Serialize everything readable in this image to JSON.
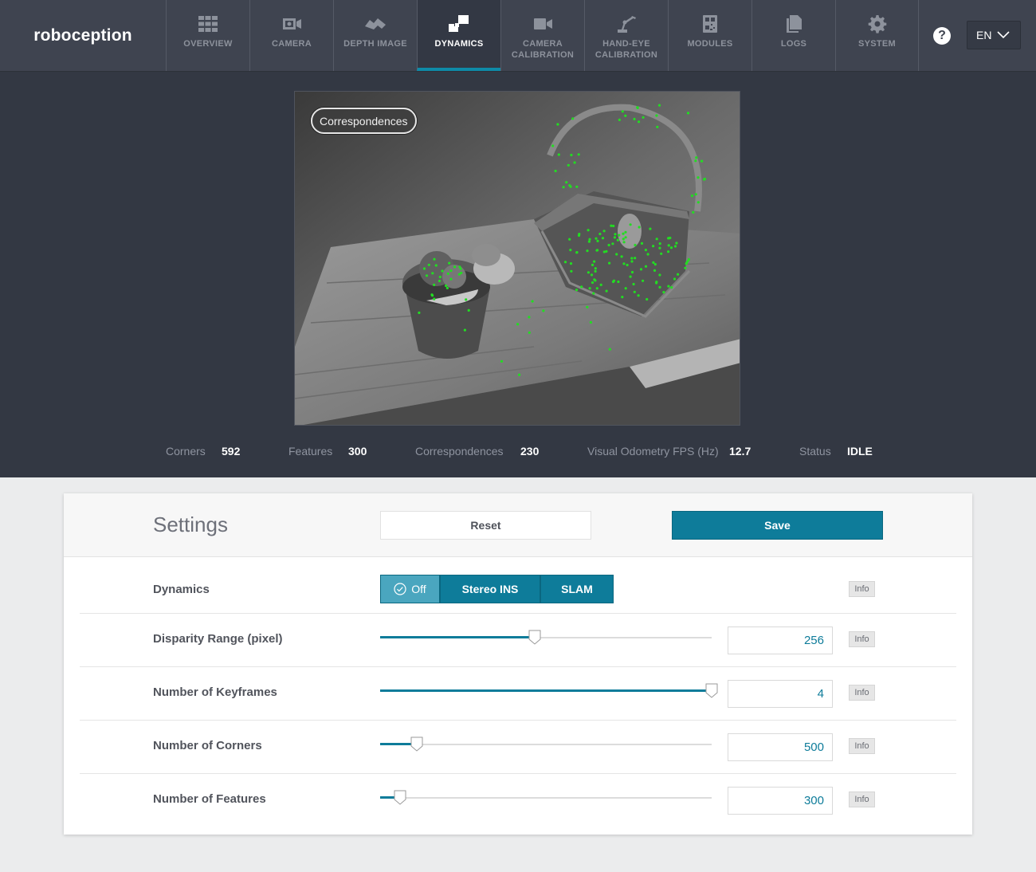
{
  "app": {
    "brand": "roboception"
  },
  "nav": {
    "items": [
      {
        "label": "OVERVIEW",
        "icon": "grid-icon"
      },
      {
        "label": "CAMERA",
        "icon": "camera-icon"
      },
      {
        "label": "DEPTH IMAGE",
        "icon": "depth-image-icon"
      },
      {
        "label": "DYNAMICS",
        "icon": "dynamics-icon",
        "active": true
      },
      {
        "label": "CAMERA\nCALIBRATION",
        "icon": "video-camera-icon"
      },
      {
        "label": "HAND-EYE\nCALIBRATION",
        "icon": "robot-arm-icon"
      },
      {
        "label": "MODULES",
        "icon": "qr-module-icon"
      },
      {
        "label": "LOGS",
        "icon": "documents-icon"
      },
      {
        "label": "SYSTEM",
        "icon": "gear-icon"
      }
    ],
    "help_label": "?",
    "language": "EN"
  },
  "viewer": {
    "badge": "Correspondences",
    "stats": [
      {
        "label": "Corners",
        "value": "592"
      },
      {
        "label": "Features",
        "value": "300"
      },
      {
        "label": "Correspondences",
        "value": "230"
      },
      {
        "label": "Visual Odometry FPS (Hz)",
        "value": "12.7"
      },
      {
        "label": "Status",
        "value": "IDLE"
      }
    ]
  },
  "settings": {
    "title": "Settings",
    "reset_label": "Reset",
    "save_label": "Save",
    "info_label": "Info",
    "dynamics": {
      "label": "Dynamics",
      "options": [
        "Off",
        "Stereo INS",
        "SLAM"
      ],
      "selected": "Off"
    },
    "params": [
      {
        "label": "Disparity Range (pixel)",
        "value": "256",
        "level": 0.466
      },
      {
        "label": "Number of Keyframes",
        "value": "4",
        "level": 1.0
      },
      {
        "label": "Number of Corners",
        "value": "500",
        "level": 0.11
      },
      {
        "label": "Number of Features",
        "value": "300",
        "level": 0.06
      }
    ]
  },
  "colors": {
    "accent": "#0e7c9a",
    "nav_bg": "#3f4450",
    "viewer_bg": "#333843",
    "feature_points": "#22dd22"
  }
}
